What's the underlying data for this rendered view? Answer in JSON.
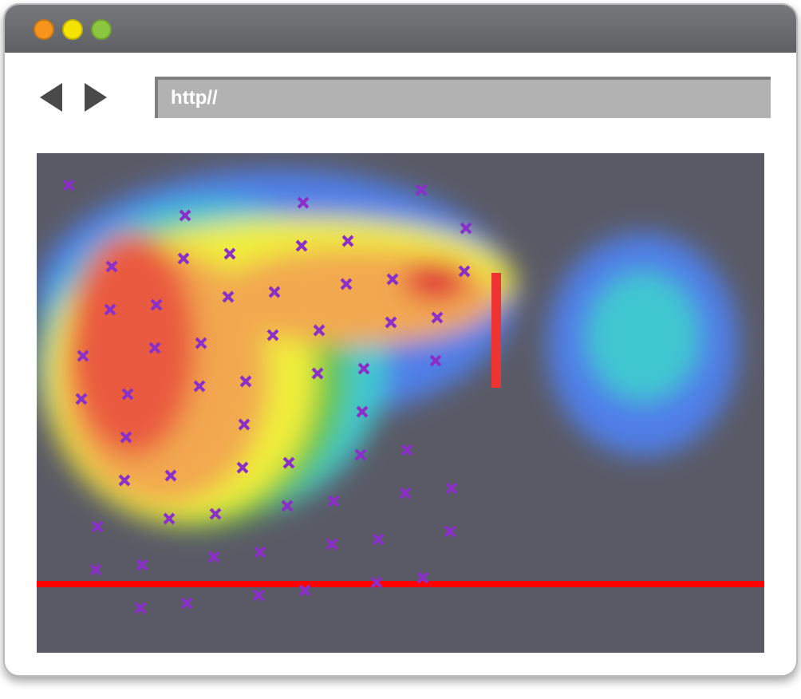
{
  "window": {
    "controls": [
      {
        "color": "#f7941d"
      },
      {
        "color": "#f5e400"
      },
      {
        "color": "#8cc63f"
      }
    ]
  },
  "address_bar": {
    "value": "http//"
  }
}
